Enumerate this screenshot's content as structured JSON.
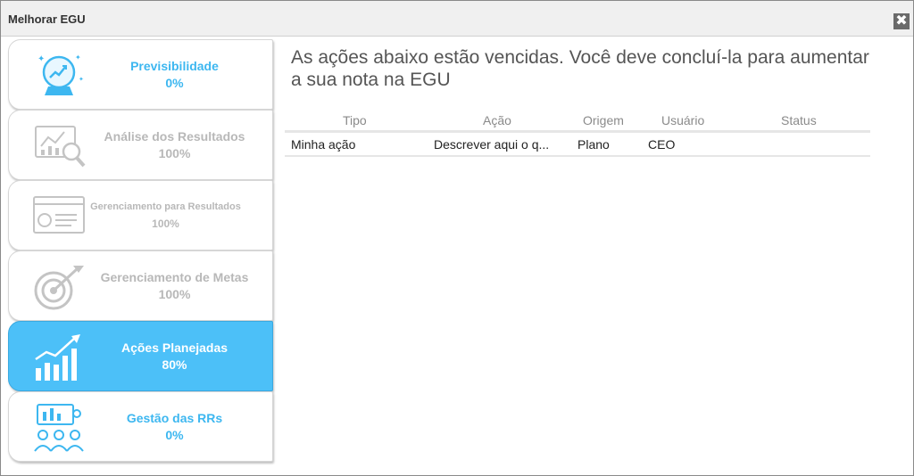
{
  "window": {
    "title": "Melhorar EGU",
    "close_glyph": "✖"
  },
  "sidebar": {
    "items": [
      {
        "icon": "crystal-ball-icon",
        "label": "Previsibilidade",
        "value": "0%"
      },
      {
        "icon": "analysis-chart-icon",
        "label": "Análise dos Resultados",
        "value": "100%"
      },
      {
        "icon": "presentation-board-icon",
        "label": "Gerenciamento para Resultados",
        "value": "100%"
      },
      {
        "icon": "target-icon",
        "label": "Gerenciamento de Metas",
        "value": "100%"
      },
      {
        "icon": "growth-chart-icon",
        "label": "Ações Planejadas",
        "value": "80%"
      },
      {
        "icon": "team-icon",
        "label": "Gestão das RRs",
        "value": "0%"
      }
    ]
  },
  "main": {
    "headline": "As ações abaixo estão vencidas. Você deve concluí-la para aumentar a sua nota na EGU",
    "table": {
      "columns": [
        "Tipo",
        "Ação",
        "Origem",
        "Usuário",
        "Status"
      ],
      "rows": [
        [
          "Minha ação",
          "Descrever aqui o q...",
          "Plano",
          "CEO",
          ""
        ]
      ]
    }
  },
  "colors": {
    "accent": "#4cc0f8",
    "accent_text": "#3db7f0",
    "muted_text": "#b8b8b8"
  }
}
